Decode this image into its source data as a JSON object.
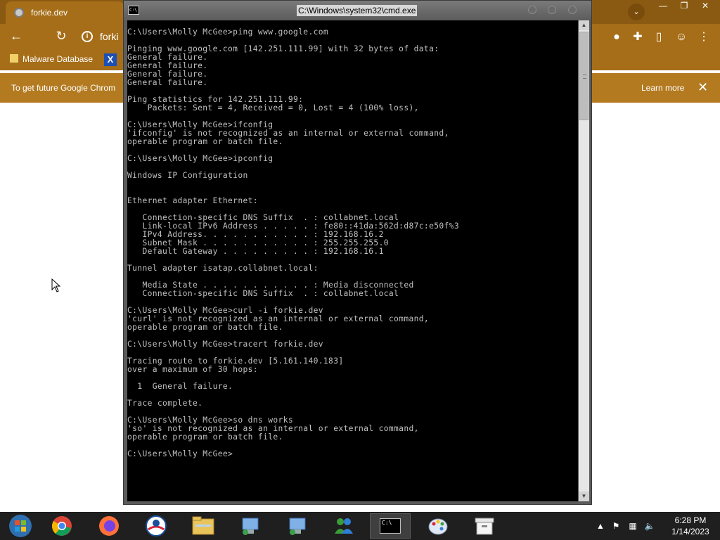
{
  "browser": {
    "tab_title": "forkie.dev",
    "address_partial": "forki",
    "bookmark_malware": "Malware Database",
    "bookmark_x_icon": "X",
    "infobar_message": "To get future Google Chrom",
    "infobar_learn_more": "Learn more",
    "infobar_close": "✕",
    "window_minimize": "—",
    "window_restore": "❐",
    "window_close": "✕"
  },
  "cmd": {
    "window_title": "C:\\Windows\\system32\\cmd.exe",
    "icon_text": "C:\\",
    "scroll_up": "▲",
    "scroll_down": "▼",
    "output": "C:\\Users\\Molly McGee>ping www.google.com\n\nPinging www.google.com [142.251.111.99] with 32 bytes of data:\nGeneral failure.\nGeneral failure.\nGeneral failure.\nGeneral failure.\n\nPing statistics for 142.251.111.99:\n    Packets: Sent = 4, Received = 0, Lost = 4 (100% loss),\n\nC:\\Users\\Molly McGee>ifconfig\n'ifconfig' is not recognized as an internal or external command,\noperable program or batch file.\n\nC:\\Users\\Molly McGee>ipconfig\n\nWindows IP Configuration\n\n\nEthernet adapter Ethernet:\n\n   Connection-specific DNS Suffix  . : collabnet.local\n   Link-local IPv6 Address . . . . . : fe80::41da:562d:d87c:e50f%3\n   IPv4 Address. . . . . . . . . . . : 192.168.16.2\n   Subnet Mask . . . . . . . . . . . : 255.255.255.0\n   Default Gateway . . . . . . . . . : 192.168.16.1\n\nTunnel adapter isatap.collabnet.local:\n\n   Media State . . . . . . . . . . . : Media disconnected\n   Connection-specific DNS Suffix  . : collabnet.local\n\nC:\\Users\\Molly McGee>curl -i forkie.dev\n'curl' is not recognized as an internal or external command,\noperable program or batch file.\n\nC:\\Users\\Molly McGee>tracert forkie.dev\n\nTracing route to forkie.dev [5.161.140.183]\nover a maximum of 30 hops:\n\n  1  General failure.\n\nTrace complete.\n\nC:\\Users\\Molly McGee>so dns works\n'so' is not recognized as an internal or external command,\noperable program or batch file.\n\nC:\\Users\\Molly McGee>"
  },
  "taskbar": {
    "apps": [
      "start-orb",
      "chrome",
      "firefox",
      "obama-icon",
      "file-explorer",
      "network-share",
      "network-share-2",
      "msn-messenger",
      "cmd",
      "paint",
      "archive"
    ],
    "cmd_icon_text": "C:\\",
    "clock_time": "6:28 PM",
    "clock_date": "1/14/2023"
  }
}
